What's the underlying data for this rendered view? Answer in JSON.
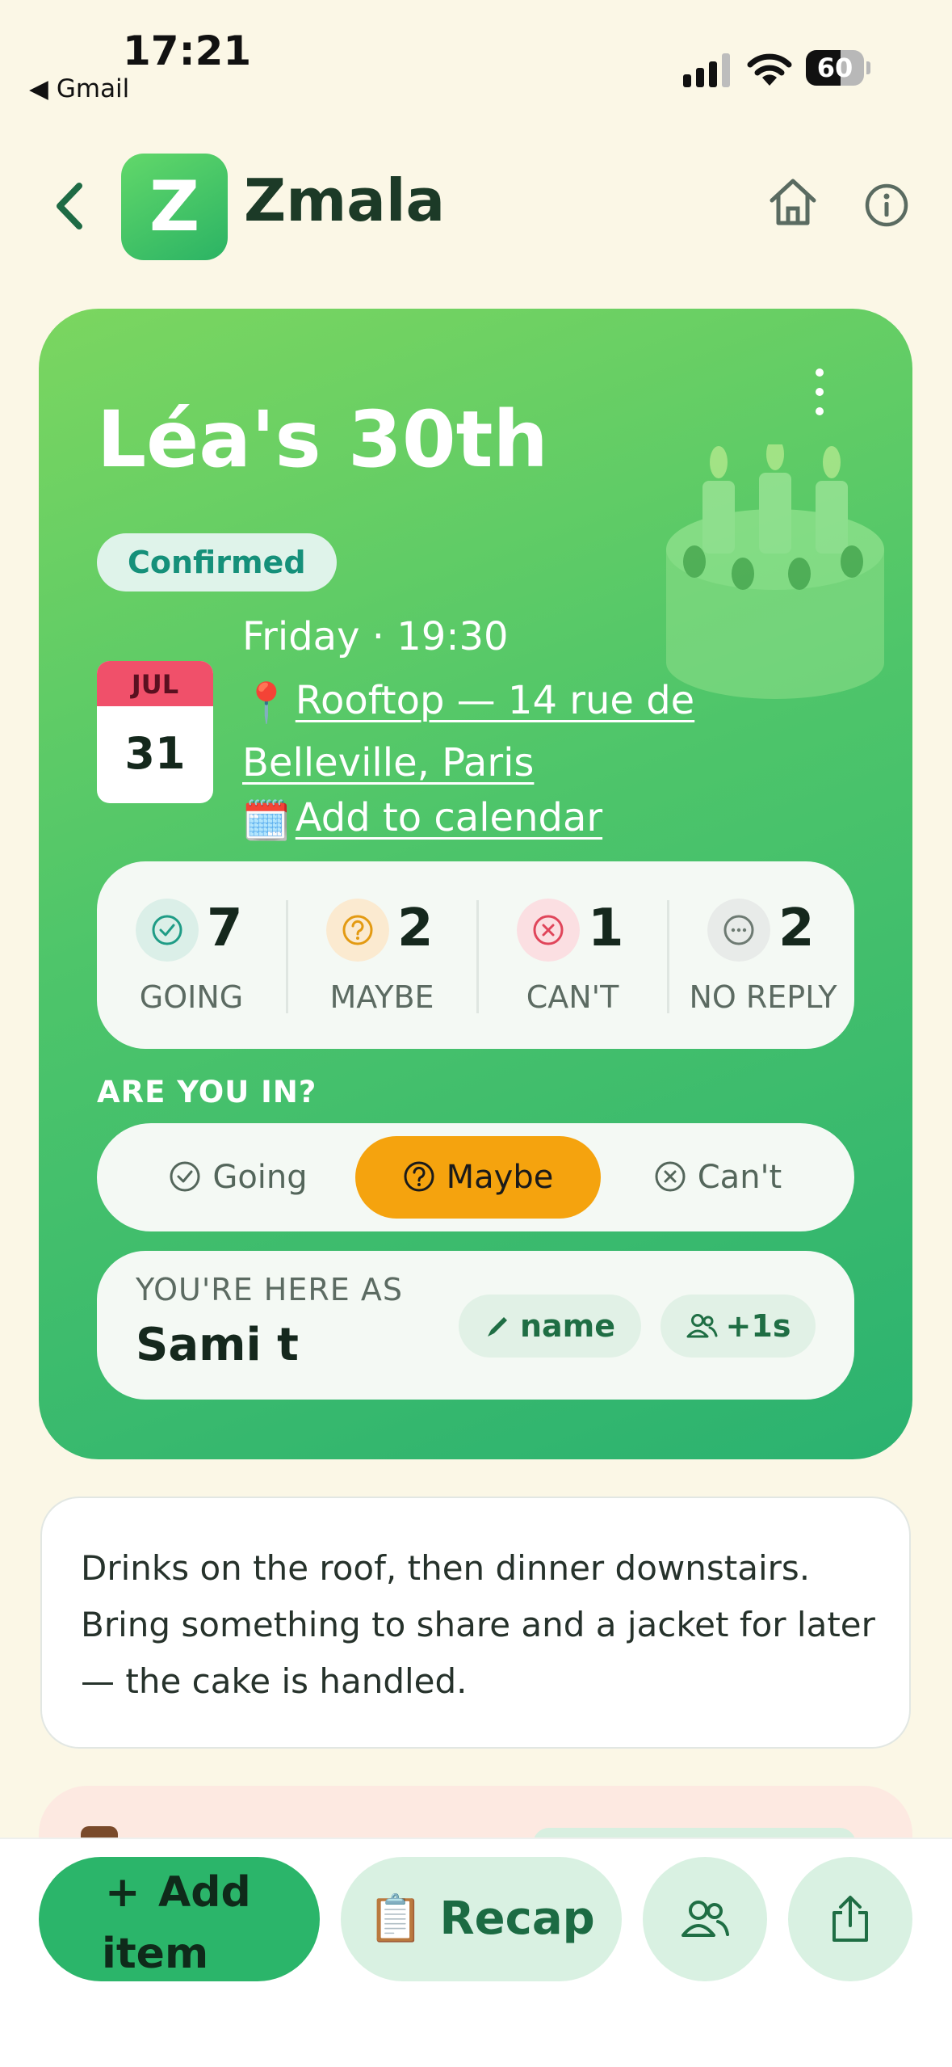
{
  "status_bar": {
    "time": "17:21",
    "back_app": "Gmail",
    "battery": "60",
    "battery_level": 0.6
  },
  "header": {
    "logo_letter": "Z",
    "app_name": "Zmala"
  },
  "event": {
    "title": "Léa's 30th",
    "status": "Confirmed",
    "month": "JUL",
    "day": "31",
    "when": "Friday · 19:30",
    "location_emoji": "📍",
    "location": "Rooftop — 14 rue de Belleville, Paris",
    "calendar_emoji": "🗓️",
    "add_to_calendar": "Add to calendar"
  },
  "stats": [
    {
      "count": "7",
      "label": "GOING",
      "icon": "check-circle-icon",
      "color": "#1f9c86",
      "bg": "#dbefe8"
    },
    {
      "count": "2",
      "label": "MAYBE",
      "icon": "question-circle-icon",
      "color": "#e39a12",
      "bg": "#fbead0"
    },
    {
      "count": "1",
      "label": "CAN'T",
      "icon": "x-circle-icon",
      "color": "#e0455a",
      "bg": "#fbdfe2"
    },
    {
      "count": "2",
      "label": "NO REPLY",
      "icon": "dots-circle-icon",
      "color": "#6d7a72",
      "bg": "#e8ebe9"
    }
  ],
  "rsvp": {
    "question": "ARE YOU IN?",
    "options": [
      {
        "label": "Going",
        "icon": "check-circle-icon",
        "selected": false
      },
      {
        "label": "Maybe",
        "icon": "question-circle-icon",
        "selected": true
      },
      {
        "label": "Can't",
        "icon": "x-circle-icon",
        "selected": false
      }
    ]
  },
  "member": {
    "label": "YOU'RE HERE AS",
    "name": "Sami t",
    "edit_label": "name",
    "plus_label": "+1s"
  },
  "note": "Drinks on the roof, then dinner downstairs. Bring something to share and a jacket for later — the cake is handled.",
  "actions": {
    "add_plus": "+",
    "add_line1": "Add",
    "add_line2": "item",
    "recap_emoji": "📋",
    "recap": "Recap"
  },
  "colors": {
    "accent": "#2bb56a",
    "selected": "#f5a30e",
    "background": "#fbf7e6"
  }
}
